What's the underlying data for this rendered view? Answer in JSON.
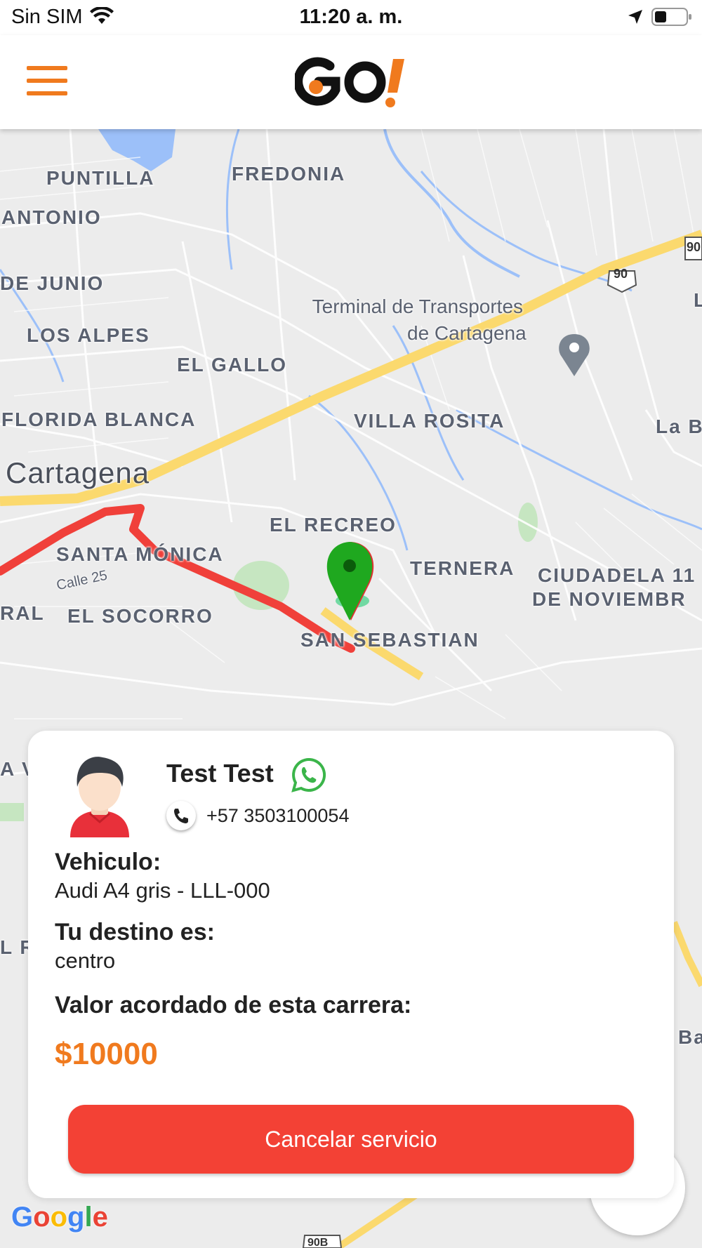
{
  "status_bar": {
    "carrier": "Sin SIM",
    "time": "11:20 a. m."
  },
  "header": {
    "logo_text": "GO!",
    "menu_icon": "hamburger-menu-icon"
  },
  "map": {
    "neighborhood_labels": [
      "PUNTILLA",
      "FREDONIA",
      "ANTONIO",
      "DE JUNIO",
      "LOS ALPES",
      "EL GALLO",
      "FLORIDA BLANCA",
      "VILLA ROSITA",
      "La B",
      "EL RECREO",
      "SANTA MÓNICA",
      "TERNERA",
      "CIUDADELA 11",
      "DE NOVIEMBR",
      "RAL",
      "EL SOCORRO",
      "SAN SEBASTIAN",
      "L",
      "A V",
      "L R",
      "Ba"
    ],
    "city_label": "Cartagena",
    "street_label": "Calle 25",
    "poi_line1": "Terminal de Transportes",
    "poi_line2": "de Cartagena",
    "route_shields": [
      "90",
      "90",
      "90B"
    ],
    "route_color": "#f0403a",
    "marker_color": "#1fa81f",
    "google_logo": "Google"
  },
  "trip_card": {
    "driver_name": "Test Test",
    "phone": "+57 3503100054",
    "vehicle_label": "Vehiculo:",
    "vehicle_value": "Audi A4 gris - LLL-000",
    "destination_label": "Tu destino es:",
    "destination_value": "centro",
    "price_label": "Valor acordado de esta carrera:",
    "price_value": "$10000",
    "cancel_label": "Cancelar servicio"
  },
  "colors": {
    "accent": "#f07a1e",
    "cancel_button": "#f34135",
    "whatsapp": "#3bb54a"
  }
}
